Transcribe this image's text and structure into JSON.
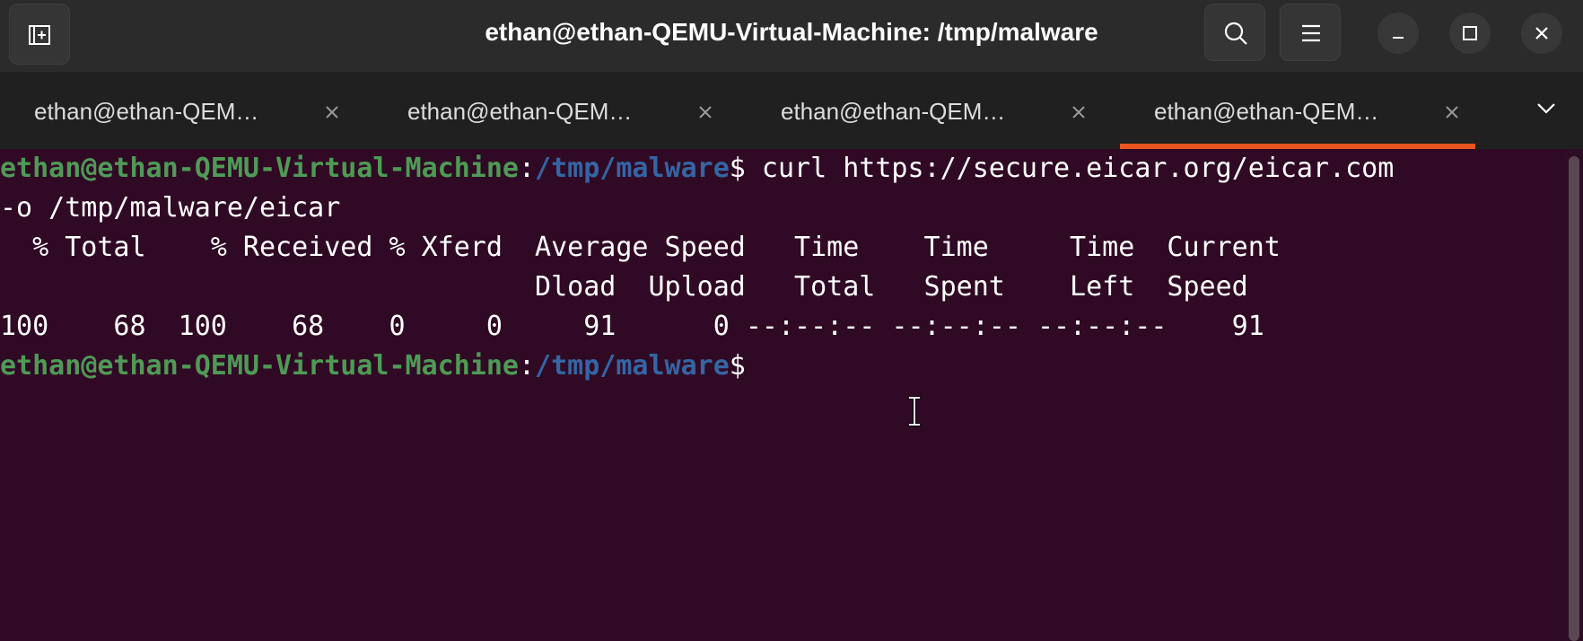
{
  "window": {
    "title": "ethan@ethan-QEMU-Virtual-Machine: /tmp/malware"
  },
  "header_buttons": {
    "new_tab": "new-tab-icon",
    "search": "search-icon",
    "menu": "hamburger-icon",
    "minimize": "minimize-icon",
    "maximize": "maximize-icon",
    "close": "close-icon"
  },
  "tabs": [
    {
      "label": "ethan@ethan-QEM…",
      "active": false
    },
    {
      "label": "ethan@ethan-QEM…",
      "active": false
    },
    {
      "label": "ethan@ethan-QEM…",
      "active": false
    },
    {
      "label": "ethan@ethan-QEM…",
      "active": true
    }
  ],
  "colors": {
    "accent": "#e95420",
    "terminal_bg": "#300a24",
    "prompt_user": "#4e9a56",
    "prompt_path": "#3465a4"
  },
  "terminal": {
    "prompt_user": "ethan@ethan-QEMU-Virtual-Machine",
    "prompt_sep": ":",
    "prompt_path": "/tmp/malware",
    "prompt_end": "$",
    "command": " curl https://secure.eicar.org/eicar.com",
    "command_cont": "-o /tmp/malware/eicar",
    "header1": "  % Total    % Received % Xferd  Average Speed   Time    Time     Time  Current",
    "header2": "                                 Dload  Upload   Total   Spent    Left  Speed",
    "progress": "100    68  100    68    0     0     91      0 --:--:-- --:--:-- --:--:--    91"
  }
}
